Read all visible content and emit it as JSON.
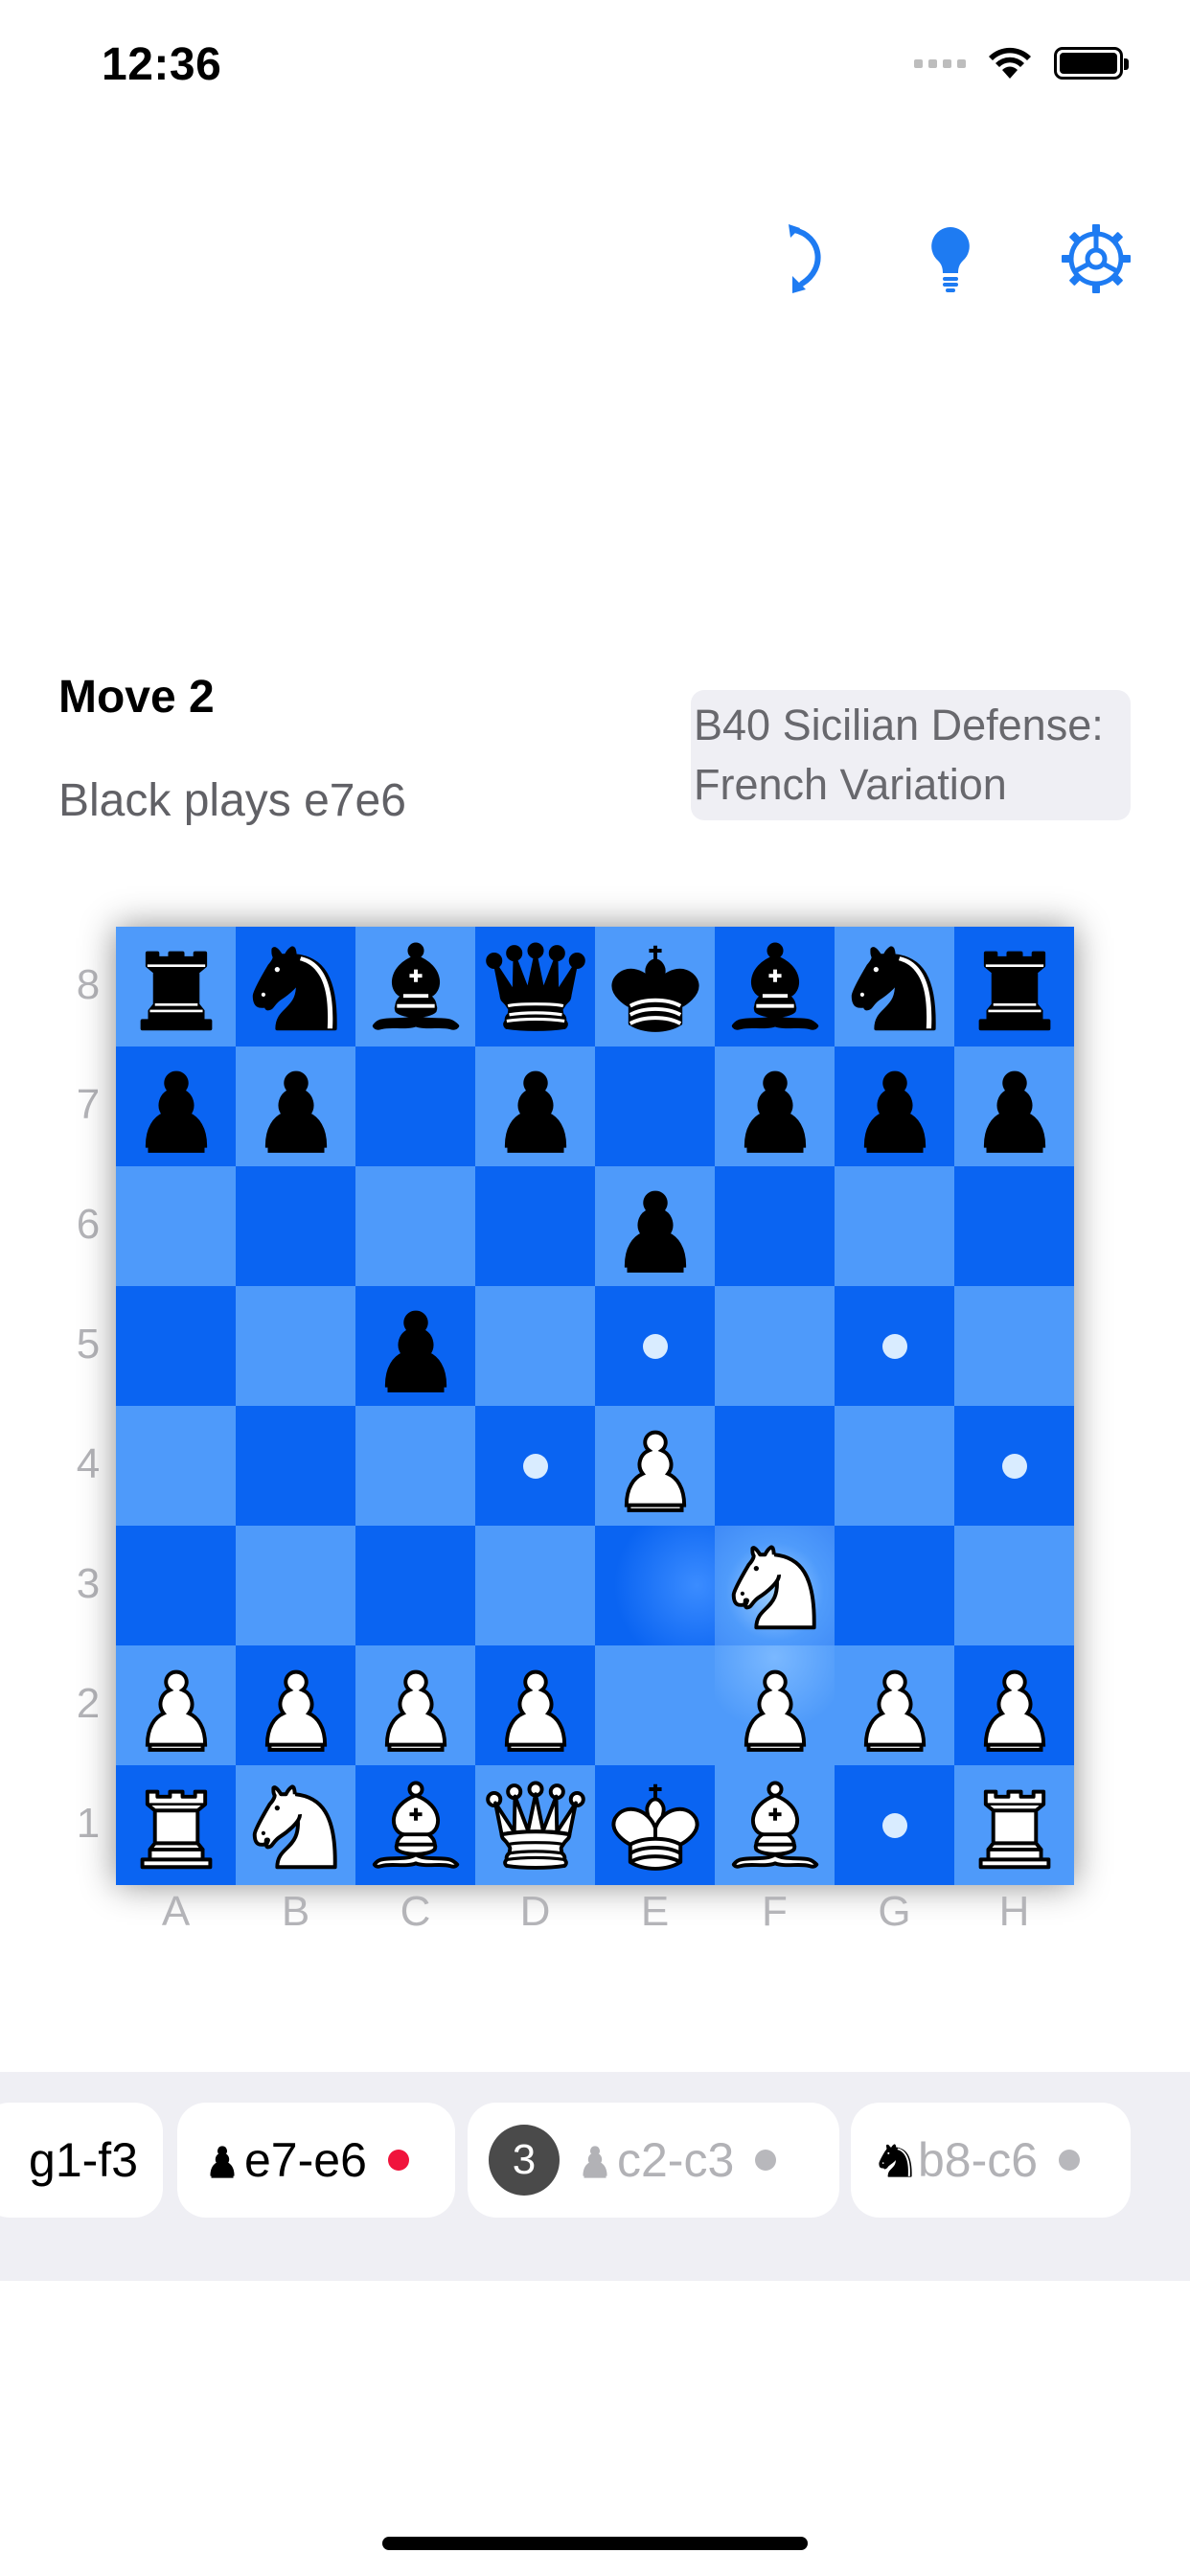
{
  "status_bar": {
    "time": "12:36"
  },
  "toolbar": {
    "icons": [
      "undo-icon",
      "lightbulb-hint-icon",
      "gear-icon"
    ],
    "accent_color": "#1e7bf2"
  },
  "move_info": {
    "title": "Move 2",
    "description": "Black plays e7e6",
    "opening": "B40 Sicilian Defense: French Variation"
  },
  "board": {
    "ranks": [
      "8",
      "7",
      "6",
      "5",
      "4",
      "3",
      "2",
      "1"
    ],
    "files": [
      "A",
      "B",
      "C",
      "D",
      "E",
      "F",
      "G",
      "H"
    ],
    "light_color": "#4e9afa",
    "dark_color": "#0a64f2",
    "rows": [
      [
        "bR",
        "bN",
        "bB",
        "bQ",
        "bK",
        "bB",
        "bN",
        "bR"
      ],
      [
        "bP",
        "bP",
        "",
        "bP",
        "",
        "bP",
        "bP",
        "bP"
      ],
      [
        "",
        "",
        "",
        "",
        "bP",
        "",
        "",
        ""
      ],
      [
        "",
        "",
        "bP",
        "",
        ".",
        "",
        ".",
        ""
      ],
      [
        "",
        "",
        "",
        ".",
        "wP",
        "",
        "",
        "."
      ],
      [
        "",
        "",
        "",
        "",
        "",
        "wN",
        "",
        ""
      ],
      [
        "wP",
        "wP",
        "wP",
        "wP",
        "",
        "wP",
        "wP",
        "wP"
      ],
      [
        "wR",
        "wN",
        "wB",
        "wQ",
        "wK",
        "wB",
        ".",
        "wR"
      ]
    ],
    "highlighted_squares": [
      "f3"
    ]
  },
  "move_strip": {
    "moves": [
      {
        "text": "g1-f3",
        "piece": "",
        "style": "played",
        "indicator_color": ""
      },
      {
        "text": "e7-e6",
        "piece": "black-pawn-icon",
        "style": "current",
        "indicator_color": "#f0143c"
      },
      {
        "number": "3",
        "text": "c2-c3",
        "piece": "white-pawn-icon",
        "style": "upcoming",
        "indicator_color": "#b8b8bc"
      },
      {
        "text": "b8-c6",
        "piece": "black-knight-icon",
        "style": "upcoming",
        "indicator_color": "#b8b8bc"
      }
    ]
  }
}
